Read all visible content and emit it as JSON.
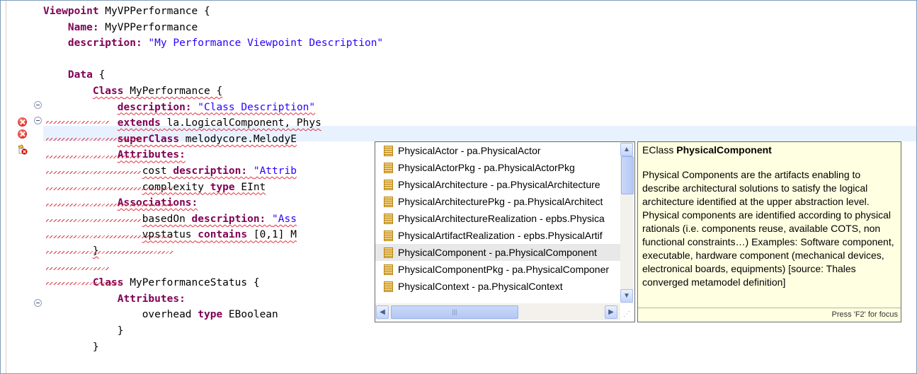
{
  "editor": {
    "lines": [
      {
        "indent": "",
        "parts": [
          {
            "t": "Viewpoint",
            "c": "kw"
          },
          {
            "t": " MyVPPerformance {"
          }
        ]
      },
      {
        "indent": "    ",
        "parts": [
          {
            "t": "Name:",
            "c": "kw"
          },
          {
            "t": " MyVPPerformance"
          }
        ]
      },
      {
        "indent": "    ",
        "parts": [
          {
            "t": "description:",
            "c": "kw"
          },
          {
            "t": " "
          },
          {
            "t": "\"My Performance Viewpoint Description\"",
            "c": "str"
          }
        ]
      },
      {
        "indent": "",
        "parts": []
      },
      {
        "indent": "    ",
        "parts": [
          {
            "t": "Data",
            "c": "kw"
          },
          {
            "t": " {"
          }
        ]
      },
      {
        "indent": "        ",
        "parts": [
          {
            "t": "Class",
            "c": "kw"
          },
          {
            "t": " MyPerformance {"
          }
        ]
      },
      {
        "indent": "            ",
        "parts": [
          {
            "t": "description:",
            "c": "kw"
          },
          {
            "t": " "
          },
          {
            "t": "\"Class Description\"",
            "c": "str"
          }
        ]
      },
      {
        "indent": "            ",
        "parts": [
          {
            "t": "extends",
            "c": "kw"
          },
          {
            "t": " la.LogicalComponent, Phys"
          }
        ]
      },
      {
        "indent": "            ",
        "parts": [
          {
            "t": "superClass",
            "c": "kw"
          },
          {
            "t": " melodycore.MelodyE"
          }
        ]
      },
      {
        "indent": "            ",
        "parts": [
          {
            "t": "Attributes:",
            "c": "kw"
          }
        ]
      },
      {
        "indent": "                ",
        "parts": [
          {
            "t": "cost "
          },
          {
            "t": "description:",
            "c": "kw"
          },
          {
            "t": " "
          },
          {
            "t": "\"Attrib",
            "c": "str"
          }
        ]
      },
      {
        "indent": "                ",
        "parts": [
          {
            "t": "complexity "
          },
          {
            "t": "type",
            "c": "kw"
          },
          {
            "t": " EInt"
          }
        ]
      },
      {
        "indent": "            ",
        "parts": [
          {
            "t": "Associations:",
            "c": "kw"
          }
        ]
      },
      {
        "indent": "                ",
        "parts": [
          {
            "t": "basedOn "
          },
          {
            "t": "description:",
            "c": "kw"
          },
          {
            "t": " "
          },
          {
            "t": "\"Ass",
            "c": "str"
          }
        ]
      },
      {
        "indent": "                ",
        "parts": [
          {
            "t": "vpstatus "
          },
          {
            "t": "contains",
            "c": "kw"
          },
          {
            "t": " [0,1] M"
          }
        ]
      },
      {
        "indent": "        ",
        "parts": [
          {
            "t": "}"
          }
        ]
      },
      {
        "indent": "",
        "parts": []
      },
      {
        "indent": "        ",
        "parts": [
          {
            "t": "Class",
            "c": "kw"
          },
          {
            "t": " MyPerformanceStatus {"
          }
        ]
      },
      {
        "indent": "            ",
        "parts": [
          {
            "t": "Attributes:",
            "c": "kw"
          }
        ]
      },
      {
        "indent": "                ",
        "parts": [
          {
            "t": "overhead "
          },
          {
            "t": "type",
            "c": "kw"
          },
          {
            "t": " EBoolean"
          }
        ]
      },
      {
        "indent": "            ",
        "parts": [
          {
            "t": "}"
          }
        ]
      },
      {
        "indent": "        ",
        "parts": [
          {
            "t": "}"
          }
        ]
      }
    ]
  },
  "completion": {
    "items": [
      "PhysicalActor - pa.PhysicalActor",
      "PhysicalActorPkg - pa.PhysicalActorPkg",
      "PhysicalArchitecture - pa.PhysicalArchitecture",
      "PhysicalArchitecturePkg - pa.PhysicalArchitect",
      "PhysicalArchitectureRealization - epbs.Physica",
      "PhysicalArtifactRealization - epbs.PhysicalArtif",
      "PhysicalComponent - pa.PhysicalComponent",
      "PhysicalComponentPkg - pa.PhysicalComponer",
      "PhysicalContext - pa.PhysicalContext"
    ],
    "selected_index": 6
  },
  "info": {
    "prefix": "EClass ",
    "name": "PhysicalComponent",
    "body": "Physical Components are the artifacts enabling to describe architectural solutions to satisfy the logical architecture identified at the upper abstraction level. Physical components are identified according to physical rationals (i.e. components reuse, available COTS, non functional constraints…) Examples: Software component, executable, hardware component (mechanical devices, electronical boards, equipments) [source: Thales converged metamodel definition]",
    "footer": "Press 'F2' for focus"
  },
  "colors": {
    "keyword": "#7f0055",
    "string": "#2a00ff",
    "error": "#e0323e",
    "current_line": "#e8f2fe",
    "tooltip_bg": "#ffffe1"
  }
}
